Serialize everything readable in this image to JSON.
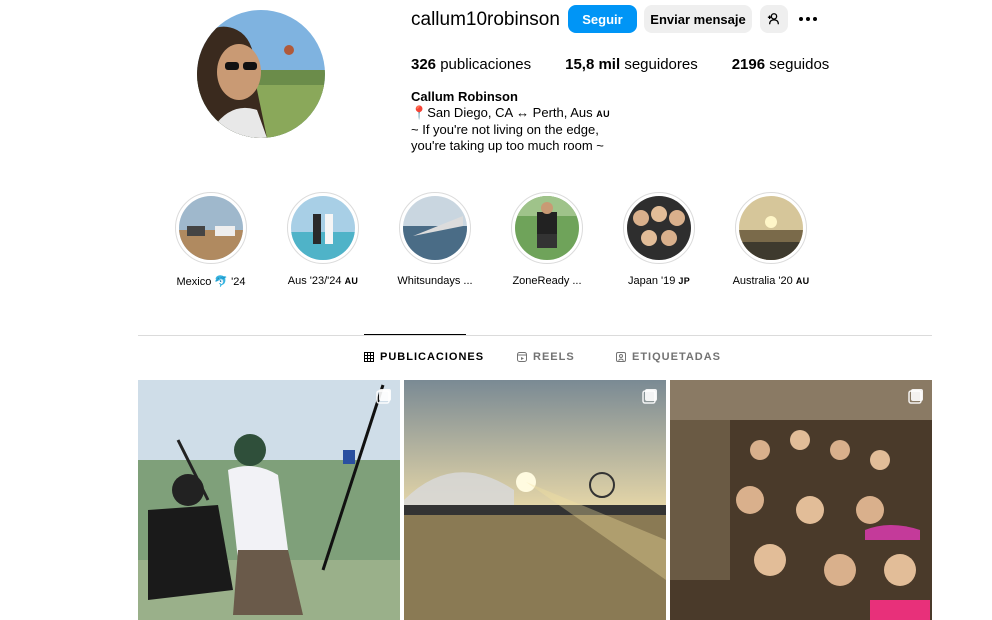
{
  "profile": {
    "username": "callum10robinson",
    "follow_label": "Seguir",
    "message_label": "Enviar mensaje",
    "posts_count": "326",
    "posts_label": "publicaciones",
    "followers_count": "15,8 mil",
    "followers_label": "seguidores",
    "following_count": "2196",
    "following_label": "seguidos",
    "full_name": "Callum Robinson",
    "bio_location": "San Diego, CA ↔ Perth, Aus",
    "bio_location_flag": "AU",
    "bio_line2": "~ If you're not living on the edge,",
    "bio_line3": "you're taking up too much room ~"
  },
  "highlights": [
    {
      "label": "Mexico 🐬 '24"
    },
    {
      "label": "Aus '23/'24",
      "flag": "AU"
    },
    {
      "label": "Whitsundays ..."
    },
    {
      "label": "ZoneReady ..."
    },
    {
      "label": "Japan '19",
      "flag": "JP"
    },
    {
      "label": "Australia '20",
      "flag": "AU"
    }
  ],
  "tabs": {
    "posts": "PUBLICACIONES",
    "reels": "REELS",
    "tagged": "ETIQUETADAS"
  },
  "colors": {
    "accent": "#0095f6",
    "secondary_button": "#efefef",
    "divider": "#dbdbdb",
    "muted_text": "#737373"
  }
}
